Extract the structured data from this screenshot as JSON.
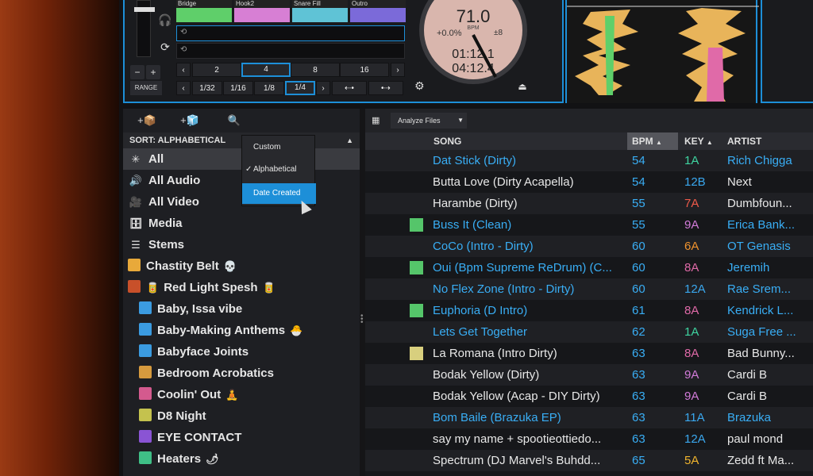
{
  "deck": {
    "range_label": "RANGE",
    "minus": "−",
    "plus": "+",
    "hotcues": [
      {
        "label": "Bridge",
        "color": "#5fcf6a"
      },
      {
        "label": "Hook2",
        "color": "#d77fd4"
      },
      {
        "label": "Snare Fill",
        "color": "#5fc3d6"
      },
      {
        "label": "Outro",
        "color": "#7b6ad9"
      }
    ],
    "loop_sizes": [
      "2",
      "4",
      "8",
      "16"
    ],
    "beat_sizes": [
      "1/32",
      "1/16",
      "1/8",
      "1/4"
    ],
    "selected_loop": "4",
    "selected_beat": "1/4",
    "platter": {
      "bpm": "71.0",
      "bpm_label": "BPM",
      "pitch": "+0.0%",
      "range": "±8",
      "elapsed": "01:12.1",
      "remaining": "04:12.4"
    },
    "accent": "#1d8fd8"
  },
  "browser": {
    "tools": [
      "+📦",
      "+🧊",
      "search-icon"
    ],
    "sort_label": "SORT: ALPHABETICAL",
    "crates": [
      {
        "label": "All",
        "icon": "✳",
        "selected": true
      },
      {
        "label": "All Audio",
        "icon": "🔊"
      },
      {
        "label": "All Video",
        "icon": "🎥"
      },
      {
        "label": "Media",
        "icon": "🗄"
      },
      {
        "label": "Stems",
        "icon": "☰"
      },
      {
        "label": "Chastity Belt",
        "color": "#e8a93a",
        "emoji": "💀"
      },
      {
        "label": "Red Light Spesh",
        "color": "#c8502a",
        "emoji": "🥫",
        "lead": "🥫"
      },
      {
        "label": "Baby, Issa vibe",
        "color": "#3b9be0",
        "indent": true
      },
      {
        "label": "Baby-Making Anthems",
        "color": "#3b9be0",
        "indent": true,
        "emoji": "🐣"
      },
      {
        "label": "Babyface Joints",
        "color": "#3b9be0",
        "indent": true
      },
      {
        "label": "Bedroom Acrobatics",
        "color": "#d69a3e",
        "indent": true
      },
      {
        "label": "Coolin' Out",
        "color": "#d45a8e",
        "indent": true,
        "emoji": "🧘"
      },
      {
        "label": "D8 Night",
        "color": "#c4c24e",
        "indent": true
      },
      {
        "label": "EYE CONTACT",
        "color": "#8a54d4",
        "indent": true
      },
      {
        "label": "Heaters",
        "color": "#3fbf86",
        "indent": true,
        "emoji": "🌶"
      }
    ],
    "sort_menu": {
      "items": [
        "Custom",
        "Alphabetical",
        "Date Created"
      ],
      "checked": "Alphabetical",
      "highlighted": "Date Created"
    }
  },
  "tracks": {
    "analyze_label": "Analyze Files",
    "columns": [
      "SONG",
      "BPM",
      "KEY",
      "ARTIST"
    ],
    "rows": [
      {
        "song": "Dat Stick (Dirty)",
        "bpm": "54",
        "key": "1A",
        "key_color": "#3fd4a0",
        "artist": "Rich Chigga",
        "blue": true
      },
      {
        "song": "Butta Love (Dirty Acapella)",
        "bpm": "54",
        "key": "12B",
        "key_color": "#3aa8ef",
        "artist": "Next",
        "blue": false
      },
      {
        "song": "Harambe (Dirty)",
        "bpm": "55",
        "key": "7A",
        "key_color": "#ef5a4a",
        "artist": "Dumbfoun...",
        "blue": false
      },
      {
        "song": "Buss It (Clean)",
        "bpm": "55",
        "key": "9A",
        "key_color": "#d27bd9",
        "artist": "Erica Bank...",
        "blue": true,
        "marker": "#55c56a"
      },
      {
        "song": "CoCo (Intro - Dirty)",
        "bpm": "60",
        "key": "6A",
        "key_color": "#f0932e",
        "artist": "OT Genasis",
        "blue": true
      },
      {
        "song": "Oui (Bpm Supreme ReDrum) (C...",
        "bpm": "60",
        "key": "8A",
        "key_color": "#e06aa8",
        "artist": "Jeremih",
        "blue": true,
        "marker": "#55c56a"
      },
      {
        "song": "No Flex Zone (Intro - Dirty)",
        "bpm": "60",
        "key": "12A",
        "key_color": "#3aa8ef",
        "artist": "Rae Srem...",
        "blue": true
      },
      {
        "song": "Euphoria (D Intro)",
        "bpm": "61",
        "key": "8A",
        "key_color": "#e06aa8",
        "artist": "Kendrick L...",
        "blue": true,
        "marker": "#55c56a"
      },
      {
        "song": "Lets Get Together",
        "bpm": "62",
        "key": "1A",
        "key_color": "#3fd4a0",
        "artist": "Suga Free ...",
        "blue": true
      },
      {
        "song": "La Romana (Intro Dirty)",
        "bpm": "63",
        "key": "8A",
        "key_color": "#e06aa8",
        "artist": "Bad Bunny...",
        "blue": false,
        "marker": "#d8cf7e"
      },
      {
        "song": "Bodak Yellow (Dirty)",
        "bpm": "63",
        "key": "9A",
        "key_color": "#d27bd9",
        "artist": "Cardi B",
        "blue": false
      },
      {
        "song": "Bodak Yellow (Acap - DIY Dirty)",
        "bpm": "63",
        "key": "9A",
        "key_color": "#d27bd9",
        "artist": "Cardi B",
        "blue": false
      },
      {
        "song": "Bom Baile (Brazuka EP)",
        "bpm": "63",
        "key": "11A",
        "key_color": "#3aa8ef",
        "artist": "Brazuka",
        "blue": true
      },
      {
        "song": "say my name + spootieottiedo...",
        "bpm": "63",
        "key": "12A",
        "key_color": "#3aa8ef",
        "artist": "paul mond",
        "blue": false
      },
      {
        "song": "Spectrum (DJ Marvel's Buhdd...",
        "bpm": "65",
        "key": "5A",
        "key_color": "#f0b42e",
        "artist": "Zedd ft Ma...",
        "blue": false
      }
    ]
  }
}
